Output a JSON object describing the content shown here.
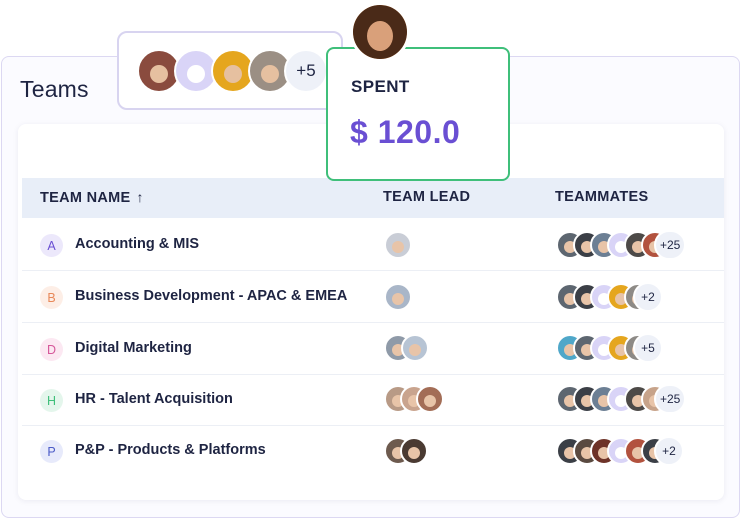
{
  "title": "Teams",
  "spent": {
    "label": "SPENT",
    "value": "$ 120.0"
  },
  "avatar_stack": {
    "more": "+5"
  },
  "table": {
    "headers": {
      "name": "TEAM NAME",
      "lead": "TEAM LEAD",
      "mates": "TEAMMATES",
      "sort_icon": "↑"
    },
    "rows": [
      {
        "letter": "A",
        "name": "Accounting & MIS",
        "more": "+25",
        "letter_color": "#6a4fd3",
        "letter_bg": "#ece8fb"
      },
      {
        "letter": "B",
        "name": "Business Development - APAC & EMEA",
        "more": "+2",
        "letter_color": "#e8895a",
        "letter_bg": "#fdeee6"
      },
      {
        "letter": "D",
        "name": "Digital Marketing",
        "more": "+5",
        "letter_color": "#d6589a",
        "letter_bg": "#fce8f2"
      },
      {
        "letter": "H",
        "name": "HR - Talent Acquisition",
        "more": "+25",
        "letter_color": "#3fbf7a",
        "letter_bg": "#e4f6ec"
      },
      {
        "letter": "P",
        "name": "P&P - Products & Platforms",
        "more": "+2",
        "letter_color": "#4b5bc7",
        "letter_bg": "#e7eafb"
      }
    ]
  }
}
